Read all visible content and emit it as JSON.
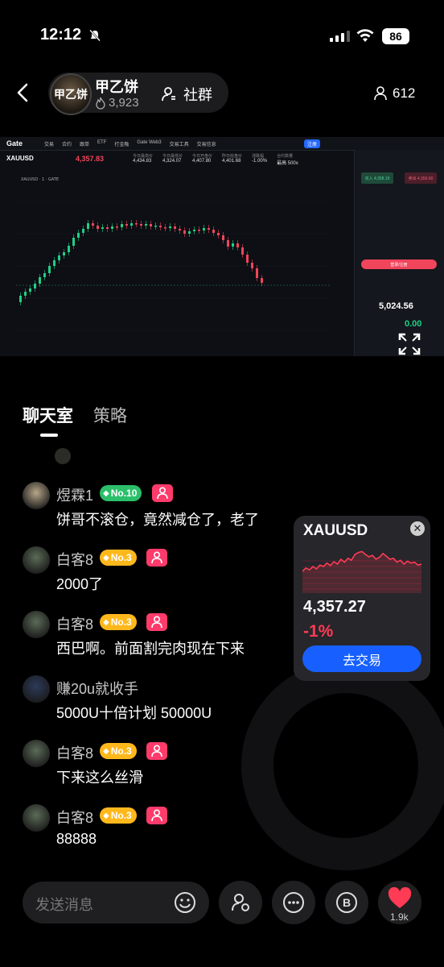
{
  "status_bar": {
    "time": "12:12",
    "battery": "86"
  },
  "header": {
    "room_name": "甲乙饼",
    "room_avatar_text": "甲乙饼",
    "room_count": "3,923",
    "community_label": "社群",
    "members_count": "612"
  },
  "trading_screenshot": {
    "logo": "Gate",
    "nav_items": [
      "交易",
      "合约",
      "跟单",
      "ETF",
      "打金融",
      "Gate Web3",
      "交易工具",
      "交易信息"
    ],
    "login_label": "注册",
    "ticker": "XAUUSD",
    "price": "4,357.83",
    "stats": [
      {
        "label": "今日最高价",
        "value": "4,434.83"
      },
      {
        "label": "今日最低价",
        "value": "4,324.07"
      },
      {
        "label": "今日开盘价",
        "value": "4,407.80"
      },
      {
        "label": "昨日收盘价",
        "value": "4,401.68"
      },
      {
        "label": "涨跌幅",
        "value": "-1.00%"
      },
      {
        "label": "合约数量",
        "value": "最高 500x"
      }
    ],
    "chart_label": "XAUUSD · 1 · GATE",
    "buy_label": "买入 4,358.19",
    "sell_label": "卖出 4,356.60",
    "red_button_label": "登录/注册",
    "big_value": "5,024.56",
    "zero_value": "0.00"
  },
  "tabs": {
    "chat_room": "聊天室",
    "strategy": "策略"
  },
  "messages": [
    {
      "name": "煜霖1",
      "level": "No.10",
      "text": "饼哥不滚仓，竟然减仓了，老了",
      "avatar_color": "#b8a68a",
      "level_color": "#2bbf6a"
    },
    {
      "name": "白客8",
      "level": "No.3",
      "text": "2000了",
      "avatar_color": "#5b6b57",
      "level_color": "#ffb81c"
    },
    {
      "name": "白客8",
      "level": "No.3",
      "text": "西巴啊。前面割完肉现在下来",
      "avatar_color": "#5b6b57",
      "level_color": "#ffb81c"
    },
    {
      "name": "赚20u就收手",
      "level": "",
      "text": "5000U十倍计划 50000U",
      "avatar_color": "#2c3a5a",
      "level_color": ""
    },
    {
      "name": "白客8",
      "level": "No.3",
      "text": "下来这么丝滑",
      "avatar_color": "#5b6b57",
      "level_color": "#ffb81c"
    },
    {
      "name": "白客8",
      "level": "No.3",
      "text": "88888",
      "avatar_color": "#5b6b57",
      "level_color": "#ffb81c"
    }
  ],
  "price_card": {
    "symbol": "XAUUSD",
    "price": "4,357.27",
    "change": "-1%",
    "trade_button": "去交易",
    "sparkline": [
      0.45,
      0.52,
      0.48,
      0.55,
      0.5,
      0.58,
      0.55,
      0.62,
      0.57,
      0.65,
      0.6,
      0.7,
      0.64,
      0.72,
      0.68,
      0.8,
      0.84,
      0.86,
      0.8,
      0.75,
      0.78,
      0.7,
      0.74,
      0.82,
      0.76,
      0.7,
      0.72,
      0.64,
      0.68,
      0.6,
      0.66,
      0.62,
      0.64,
      0.58,
      0.6
    ]
  },
  "bottom_bar": {
    "input_placeholder": "发送消息",
    "like_count": "1.9k"
  },
  "colors": {
    "accent_blue": "#1760ff",
    "pink_badge": "#ff3b6b",
    "down_red": "#ff3b55",
    "up_green": "#1fcf85"
  }
}
